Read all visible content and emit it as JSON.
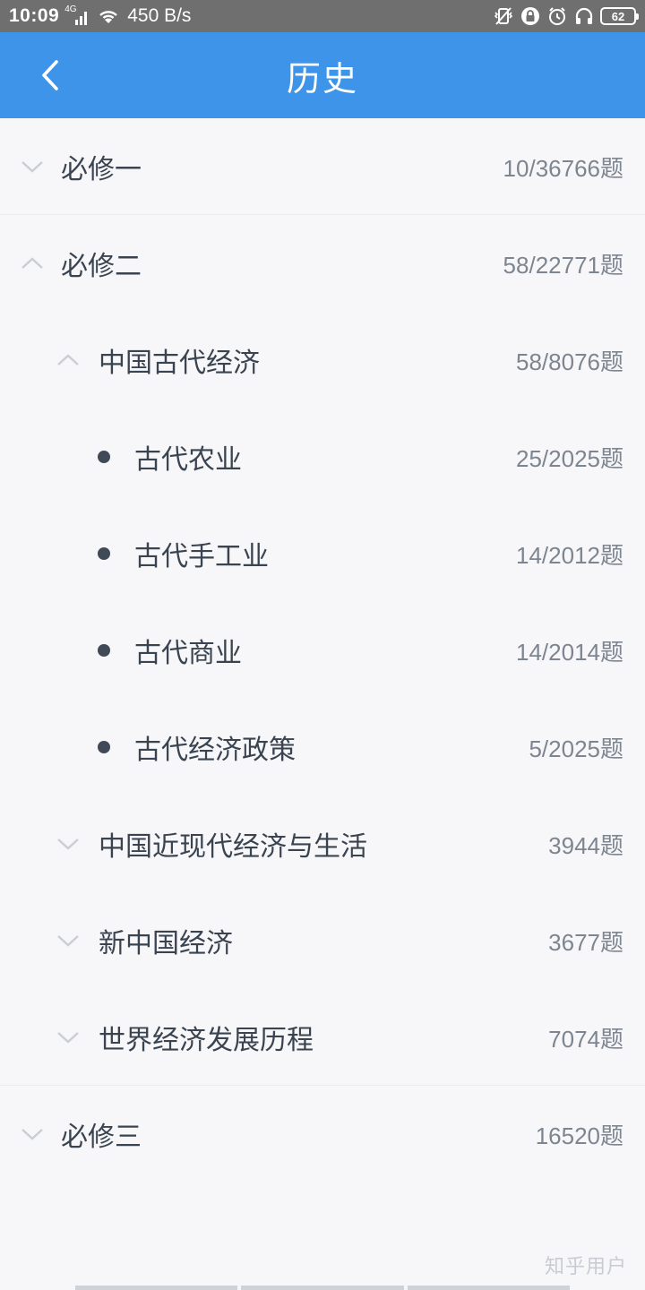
{
  "status_bar": {
    "time": "10:09",
    "network": "4G",
    "speed": "450 B/s",
    "battery": "62",
    "icons": [
      "signal-icon",
      "wifi-icon",
      "vibrate-icon",
      "lock-icon",
      "alarm-icon",
      "headset-icon",
      "battery-icon"
    ]
  },
  "appbar": {
    "title": "历史",
    "back_icon": "chevron-left-icon"
  },
  "colors": {
    "appbar": "#3d94e9",
    "background": "#f7f7f9",
    "text": "#3a4450",
    "count": "#7d8590"
  },
  "rows": [
    {
      "level": 0,
      "label": "必修一",
      "count": "10/36766题",
      "expanded": false
    },
    {
      "level": 0,
      "label": "必修二",
      "count": "58/22771题",
      "expanded": true
    },
    {
      "level": 1,
      "label": "中国古代经济",
      "count": "58/8076题",
      "expanded": true
    },
    {
      "level": 2,
      "label": "古代农业",
      "count": "25/2025题"
    },
    {
      "level": 2,
      "label": "古代手工业",
      "count": "14/2012题"
    },
    {
      "level": 2,
      "label": "古代商业",
      "count": "14/2014题"
    },
    {
      "level": 2,
      "label": "古代经济政策",
      "count": "5/2025题"
    },
    {
      "level": 1,
      "label": "中国近现代经济与生活",
      "count": "3944题",
      "expanded": false
    },
    {
      "level": 1,
      "label": "新中国经济",
      "count": "3677题",
      "expanded": false
    },
    {
      "level": 1,
      "label": "世界经济发展历程",
      "count": "7074题",
      "expanded": false
    },
    {
      "level": 0,
      "label": "必修三",
      "count": "16520题",
      "expanded": false
    }
  ],
  "watermark": "知乎用户"
}
